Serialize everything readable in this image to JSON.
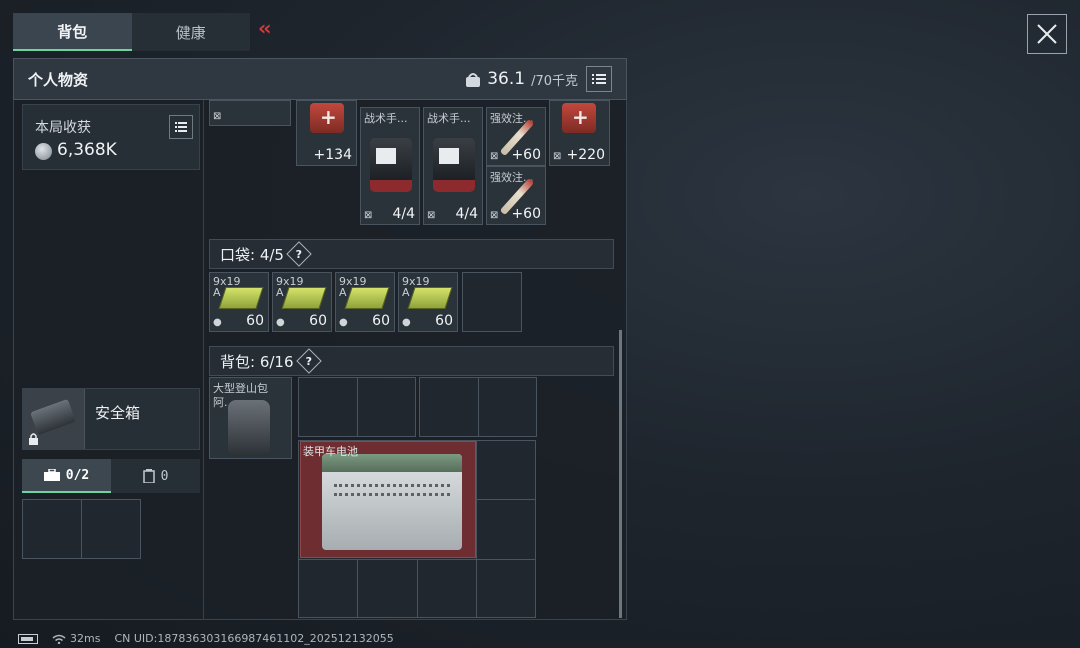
{
  "tabs": [
    {
      "label": "背包",
      "active": true
    },
    {
      "label": "健康",
      "active": false
    }
  ],
  "collapse_icon": "double-chevron-left-icon",
  "close_icon": "close-icon",
  "panel": {
    "title": "个人物资",
    "weight_current": "36.1",
    "weight_max": "/70千克"
  },
  "harvest": {
    "label": "本局收获",
    "value": "6,368K"
  },
  "top_items": [
    {
      "name": "",
      "qty": "+134",
      "type": "medkit"
    },
    {
      "name": "战术手...",
      "qty": "4/4",
      "type": "pouch"
    },
    {
      "name": "战术手...",
      "qty": "4/4",
      "type": "pouch"
    },
    {
      "name": "强效注...",
      "qty": "+60",
      "type": "syringe"
    },
    {
      "name": "强效注...",
      "qty": "+60",
      "type": "syringe"
    },
    {
      "name": "",
      "qty": "+220",
      "type": "medkit"
    }
  ],
  "pocket": {
    "label": "口袋: 4/5",
    "items": [
      {
        "name": "9x19",
        "name2": "A",
        "qty": "60"
      },
      {
        "name": "9x19",
        "name2": "A",
        "qty": "60"
      },
      {
        "name": "9x19",
        "name2": "A",
        "qty": "60"
      },
      {
        "name": "9x19",
        "name2": "A",
        "qty": "60"
      }
    ]
  },
  "backpack": {
    "label": "背包: 6/16",
    "bag_name": "大型登山包",
    "bag_name2": "阿... ",
    "battery_name": "装甲车电池"
  },
  "safe_box": {
    "label": "安全箱",
    "tab1": "0/2",
    "tab2": "0"
  },
  "status": {
    "ping": "32ms",
    "uid": "CN UID:18783630316698746​1102_202512132055"
  },
  "colors": {
    "accent_green": "#6fd3a0",
    "danger_red": "#d63a3a",
    "battery_bg": "#6e2d30"
  }
}
